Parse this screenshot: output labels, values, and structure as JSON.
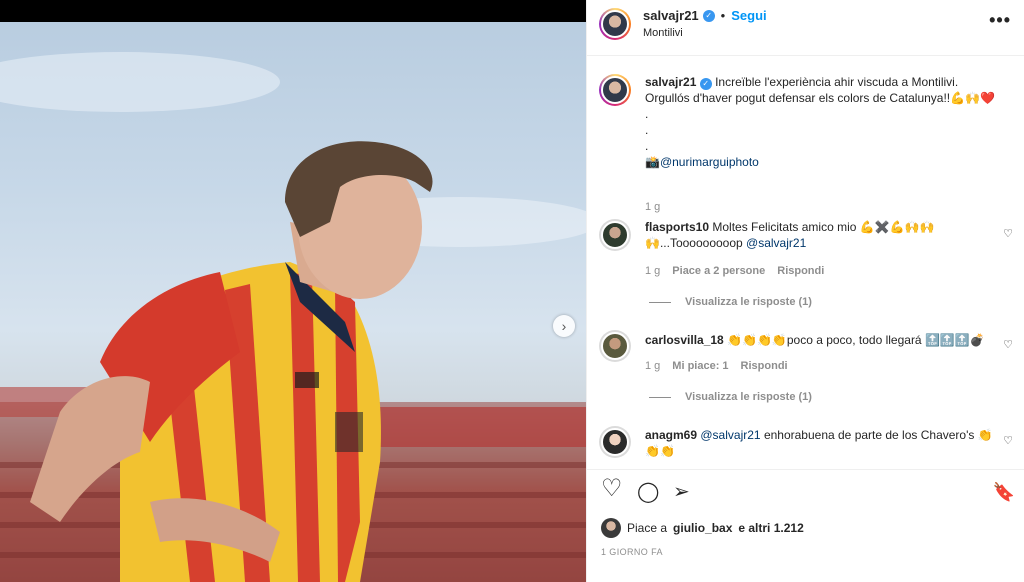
{
  "post": {
    "author": "salvajr21",
    "separator": "•",
    "follow_label": "Segui",
    "location": "Montilivi",
    "more_label": "•••",
    "caption_line1": "Increïble l'experiència ahir viscuda a Montilivi.",
    "caption_line2": "Orgullós d'haver pogut defensar els colors de Catalunya!!💪🙌❤️",
    "caption_dot": ".",
    "caption_credit_prefix": "📸",
    "caption_credit": "@nurimarguiphoto",
    "caption_time": "1 g"
  },
  "comments": [
    {
      "user": "flasports10",
      "text": "Moltes Felicitats amico mio 💪✖️💪🙌🙌 🙌...Tooooooooop",
      "mention": "@salvajr21",
      "time": "1 g",
      "likes": "Piace a 2 persone",
      "reply": "Rispondi",
      "view_replies": "Visualizza le risposte (1)"
    },
    {
      "user": "carlosvilla_18",
      "text": "👏👏👏👏poco a poco, todo llegará 🔝🔝🔝💣",
      "time": "1 g",
      "likes": "Mi piace: 1",
      "reply": "Rispondi",
      "view_replies": "Visualizza le risposte (1)"
    },
    {
      "user": "anagm69",
      "mention": "@salvajr21",
      "text": "enhorabuena de parte de los Chavero's 👏👏👏"
    }
  ],
  "actions": {
    "like_icon": "♡",
    "comment_icon": "◯",
    "share_icon": "➢",
    "save_icon": "🔖"
  },
  "likes": {
    "prefix": "Piace a",
    "user": "giulio_bax",
    "suffix": "e altri 1.212"
  },
  "time_ago": "1 GIORNO FA",
  "carousel": {
    "slides": 4,
    "active": 0
  },
  "colors": {
    "accent": "#0095f6",
    "muted": "#8e8e8e",
    "mention": "#00376b"
  }
}
